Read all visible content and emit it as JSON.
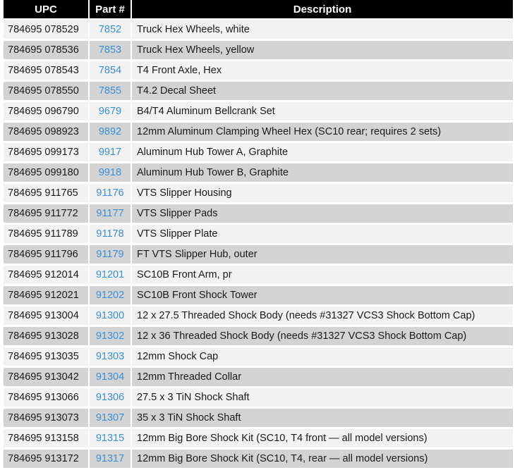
{
  "table": {
    "headers": {
      "upc": "UPC",
      "part": "Part #",
      "description": "Description"
    },
    "rows": [
      {
        "upc": "784695 078529",
        "part": "7852",
        "description": "Truck Hex Wheels, white"
      },
      {
        "upc": "784695 078536",
        "part": "7853",
        "description": "Truck Hex Wheels, yellow"
      },
      {
        "upc": "784695 078543",
        "part": "7854",
        "description": "T4 Front Axle, Hex"
      },
      {
        "upc": "784695 078550",
        "part": "7855",
        "description": "T4.2 Decal Sheet"
      },
      {
        "upc": "784695 096790",
        "part": "9679",
        "description": "B4/T4 Aluminum Bellcrank Set"
      },
      {
        "upc": "784695 098923",
        "part": "9892",
        "description": "12mm Aluminum Clamping Wheel Hex (SC10 rear; requires 2 sets)"
      },
      {
        "upc": "784695 099173",
        "part": "9917",
        "description": "Aluminum Hub Tower A, Graphite"
      },
      {
        "upc": "784695 099180",
        "part": "9918",
        "description": "Aluminum Hub Tower B, Graphite"
      },
      {
        "upc": "784695 911765",
        "part": "91176",
        "description": "VTS Slipper Housing"
      },
      {
        "upc": "784695 911772",
        "part": "91177",
        "description": "VTS Slipper Pads"
      },
      {
        "upc": "784695 911789",
        "part": "91178",
        "description": "VTS Slipper Plate"
      },
      {
        "upc": "784695 911796",
        "part": "91179",
        "description": "FT VTS Slipper Hub, outer"
      },
      {
        "upc": "784695 912014",
        "part": "91201",
        "description": "SC10B Front Arm, pr"
      },
      {
        "upc": "784695 912021",
        "part": "91202",
        "description": "SC10B Front Shock Tower"
      },
      {
        "upc": "784695 913004",
        "part": "91300",
        "description": "12 x 27.5 Threaded Shock Body (needs #31327 VCS3 Shock Bottom Cap)"
      },
      {
        "upc": "784695 913028",
        "part": "91302",
        "description": "12 x 36 Threaded Shock Body (needs #31327 VCS3 Shock Bottom Cap)"
      },
      {
        "upc": "784695 913035",
        "part": "91303",
        "description": "12mm Shock Cap"
      },
      {
        "upc": "784695 913042",
        "part": "91304",
        "description": "12mm Threaded Collar"
      },
      {
        "upc": "784695 913066",
        "part": "91306",
        "description": "27.5 x 3 TiN Shock Shaft"
      },
      {
        "upc": "784695 913073",
        "part": "91307",
        "description": "35 x 3 TiN Shock Shaft"
      },
      {
        "upc": "784695 913158",
        "part": "91315",
        "description": "12mm Big Bore Shock Kit (SC10, T4 front — all model versions)"
      },
      {
        "upc": "784695 913172",
        "part": "91317",
        "description": "12mm Big Bore Shock Kit (SC10, T4, rear — all model versions)"
      }
    ]
  },
  "colors": {
    "header_bg": "#000000",
    "header_text": "#ffffff",
    "row_odd_bg": "#f2f2f2",
    "row_even_bg": "#d3d3d3",
    "link": "#3a8fd8"
  }
}
